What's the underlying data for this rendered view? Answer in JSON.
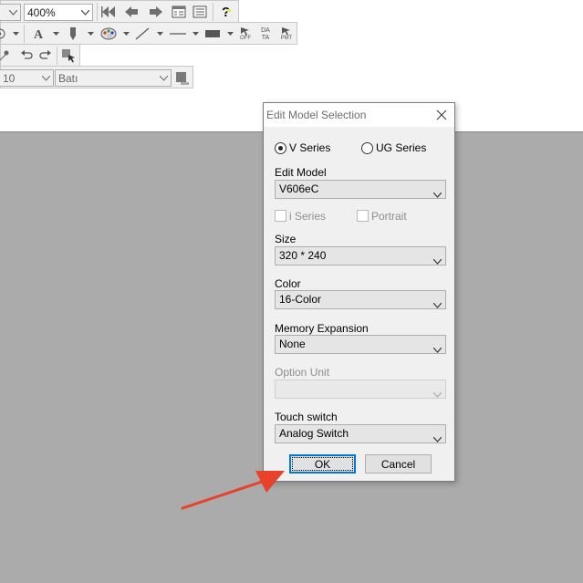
{
  "toolbar": {
    "zoom_value": "400%",
    "font_size_value": "10",
    "font_name_value": "Batı",
    "off_label": "OFF",
    "data_label": "DA TA",
    "pmt_label": "PMT"
  },
  "dialog": {
    "title": "Edit Model Selection",
    "series": {
      "v_series_label": "V Series",
      "ug_series_label": "UG Series",
      "selected": "V Series"
    },
    "edit_model": {
      "label": "Edit Model",
      "value": "V606eC"
    },
    "i_series_label": "i Series",
    "portrait_label": "Portrait",
    "size": {
      "label": "Size",
      "value": "320 * 240"
    },
    "color": {
      "label": "Color",
      "value": "16-Color"
    },
    "memory_expansion": {
      "label": "Memory Expansion",
      "value": "None"
    },
    "option_unit": {
      "label": "Option Unit",
      "value": ""
    },
    "touch_switch": {
      "label": "Touch switch",
      "value": "Analog Switch"
    },
    "ok_label": "OK",
    "cancel_label": "Cancel"
  },
  "colors": {
    "annotation_arrow": "#e8412c",
    "default_button_border": "#0078d7",
    "workspace_gray": "#ababab"
  }
}
